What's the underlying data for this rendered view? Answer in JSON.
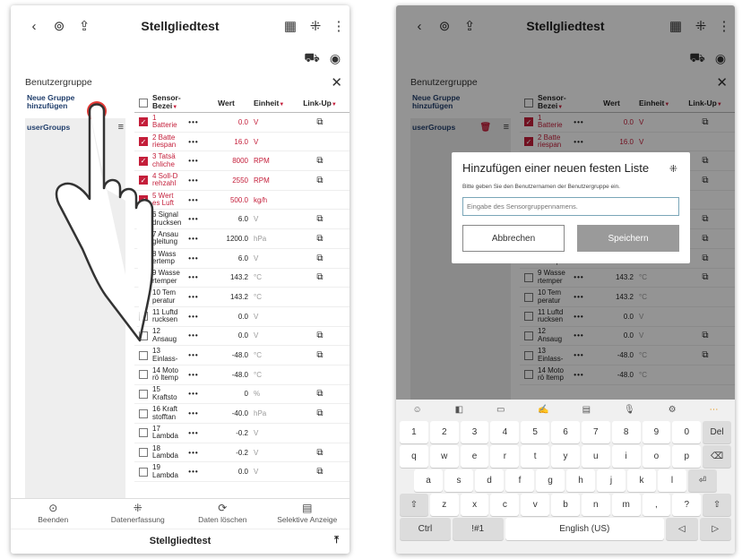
{
  "header": {
    "title": "Stellgliedtest",
    "back_icon": "chevron-left-icon",
    "bottom_title": "Stellgliedtest"
  },
  "group_panel": {
    "label": "Benutzergruppe",
    "new_group": "Neue Gruppe\nhinzufügen",
    "user_groups": "userGroups"
  },
  "table": {
    "headers": {
      "name": "Sensor-Bezei",
      "value": "Wert",
      "unit": "Einheit",
      "link": "Link-Up"
    },
    "rows": [
      {
        "name": "1 Batterie",
        "value": "0.0",
        "unit": "V",
        "checked": true,
        "link": true
      },
      {
        "name": "2 Batte riespan",
        "value": "16.0",
        "unit": "V",
        "checked": true,
        "link": false
      },
      {
        "name": "3 Tatsä chliche",
        "value": "8000",
        "unit": "RPM",
        "checked": true,
        "link": true
      },
      {
        "name": "4 Soll-D rehzahl",
        "value": "2550",
        "unit": "RPM",
        "checked": true,
        "link": true
      },
      {
        "name": "5 Wert es Luft",
        "value": "500.0",
        "unit": "kg/h",
        "checked": true,
        "link": false
      },
      {
        "name": "6 Signal drucksen",
        "value": "6.0",
        "unit": "V",
        "checked": false,
        "link": true
      },
      {
        "name": "7 Ansau gleitung",
        "value": "1200.0",
        "unit": "hPa",
        "checked": false,
        "link": true
      },
      {
        "name": "8 Wass ertemp",
        "value": "6.0",
        "unit": "V",
        "checked": false,
        "link": true
      },
      {
        "name": "9 Wasse rtemper",
        "value": "143.2",
        "unit": "°C",
        "checked": false,
        "link": true
      },
      {
        "name": "10 Tem peratur",
        "value": "143.2",
        "unit": "°C",
        "checked": false,
        "link": false
      },
      {
        "name": "11 Luftd rucksen",
        "value": "0.0",
        "unit": "V",
        "checked": false,
        "link": false
      },
      {
        "name": "12 Ansaug",
        "value": "0.0",
        "unit": "V",
        "checked": false,
        "link": true
      },
      {
        "name": "13 Einlass-",
        "value": "-48.0",
        "unit": "°C",
        "checked": false,
        "link": true
      },
      {
        "name": "14 Moto rö ltemp",
        "value": "-48.0",
        "unit": "°C",
        "checked": false,
        "link": false
      },
      {
        "name": "15 Kraftsto",
        "value": "0",
        "unit": "%",
        "checked": false,
        "link": true
      },
      {
        "name": "16 Kraft stofftan",
        "value": "-40.0",
        "unit": "hPa",
        "checked": false,
        "link": true
      },
      {
        "name": "17 Lambda",
        "value": "-0.2",
        "unit": "V",
        "checked": false,
        "link": false
      },
      {
        "name": "18 Lambda",
        "value": "-0.2",
        "unit": "V",
        "checked": false,
        "link": true
      },
      {
        "name": "19 Lambda",
        "value": "0.0",
        "unit": "V",
        "checked": false,
        "link": true
      }
    ]
  },
  "bottom_nav": [
    {
      "label": "Beenden",
      "icon": "exit-icon"
    },
    {
      "label": "Datenerfassung",
      "icon": "capture-icon"
    },
    {
      "label": "Daten löschen",
      "icon": "refresh-icon"
    },
    {
      "label": "Selektive Anzeige",
      "icon": "filter-icon"
    }
  ],
  "dialog": {
    "title": "Hinzufügen einer neuen festen Liste",
    "subtitle": "Bitte geben Sie den Benutzernamen der Benutzergruppe ein.",
    "placeholder": "Eingabe des Sensorgruppennamens.",
    "cancel": "Abbrechen",
    "save": "Speichern"
  },
  "keyboard": {
    "numbers": [
      "1",
      "2",
      "3",
      "4",
      "5",
      "6",
      "7",
      "8",
      "9",
      "0",
      "Del"
    ],
    "row1": [
      "q",
      "w",
      "e",
      "r",
      "t",
      "y",
      "u",
      "i",
      "o",
      "p",
      "⌫"
    ],
    "row2": [
      "a",
      "s",
      "d",
      "f",
      "g",
      "h",
      "j",
      "k",
      "l",
      "⏎"
    ],
    "row3": [
      "⇧",
      "z",
      "x",
      "c",
      "v",
      "b",
      "n",
      "m",
      ",",
      "?",
      "⇧"
    ],
    "row4_left": [
      "Ctrl",
      "!#1"
    ],
    "space": "English (US)",
    "row4_right": [
      "◁",
      "▷"
    ]
  },
  "colors": {
    "accent": "#c41e3a",
    "save_btn": "#9a9a9a"
  }
}
